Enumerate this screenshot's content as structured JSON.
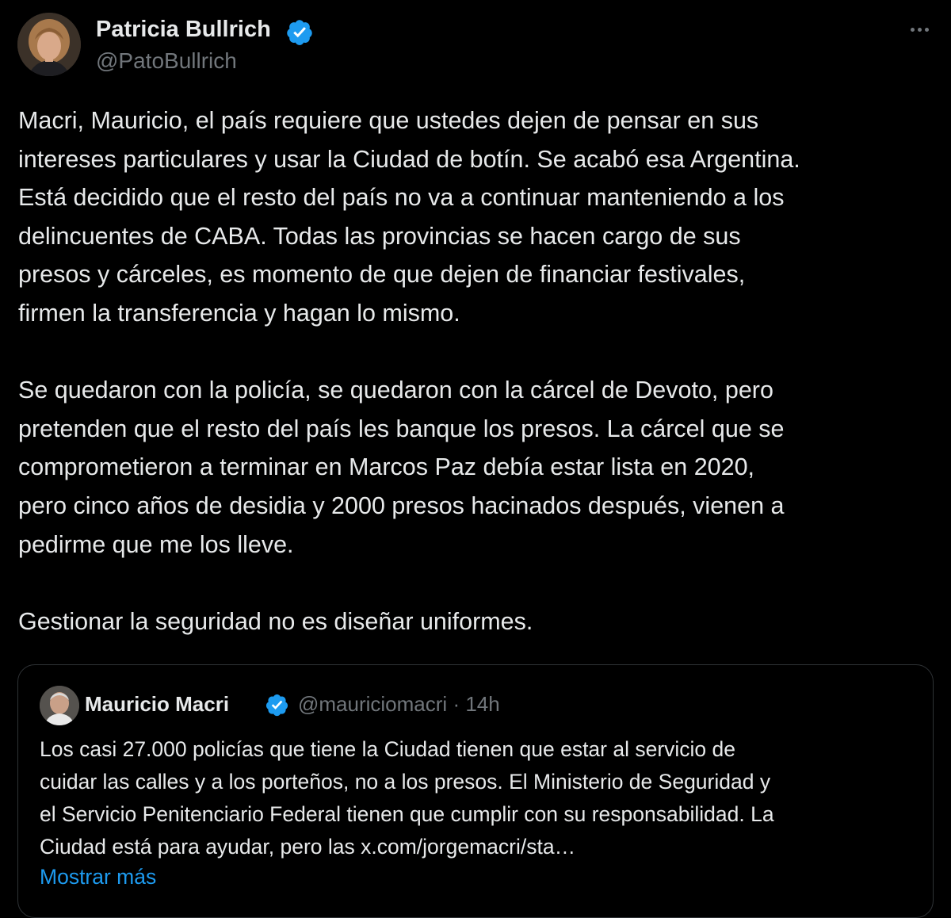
{
  "tweet": {
    "author_name": "Patricia Bullrich",
    "handle": "@PatoBullrich",
    "verified_icon": "verified-badge-icon",
    "more_icon": "more-options-icon",
    "text_lines": [
      "Macri, Mauricio, el país requiere que ustedes dejen de pensar en sus",
      "intereses particulares y usar la Ciudad de botín. Se acabó esa Argentina.",
      "Está decidido que el resto del país no va a continuar manteniendo a los",
      "delincuentes de CABA. Todas las provincias se hacen cargo de sus",
      "presos y cárceles, es momento de que dejen de financiar festivales,",
      "firmen la transferencia y hagan lo mismo.",
      "",
      "Se quedaron con la policía, se quedaron con la cárcel de Devoto, pero",
      "pretenden que el resto del país les banque los presos. La cárcel que se",
      "comprometieron a terminar en Marcos Paz debía estar lista en 2020,",
      "pero cinco años de desidia y 2000 presos hacinados después, vienen a",
      "pedirme que me los lleve.",
      "",
      "Gestionar la seguridad no es diseñar uniformes."
    ]
  },
  "quote": {
    "author_name": "Mauricio Macri",
    "handle": "@mauriciomacri",
    "separator": "·",
    "time": "14h",
    "text_lines": [
      "Los casi 27.000 policías que tiene la Ciudad tienen que estar al servicio de",
      "cuidar las calles y a los porteños, no a los presos. El Ministerio de Seguridad y",
      "el Servicio Penitenciario Federal tienen que cumplir con su responsabilidad. La",
      "Ciudad está para ayudar, pero las x.com/jorgemacri/sta…"
    ],
    "show_more": "Mostrar más"
  },
  "colors": {
    "background": "#000000",
    "text": "#e7e9ea",
    "secondary": "#71767b",
    "link": "#1d9bf0",
    "verified": "#1d9bf0",
    "border": "#2f3336"
  }
}
